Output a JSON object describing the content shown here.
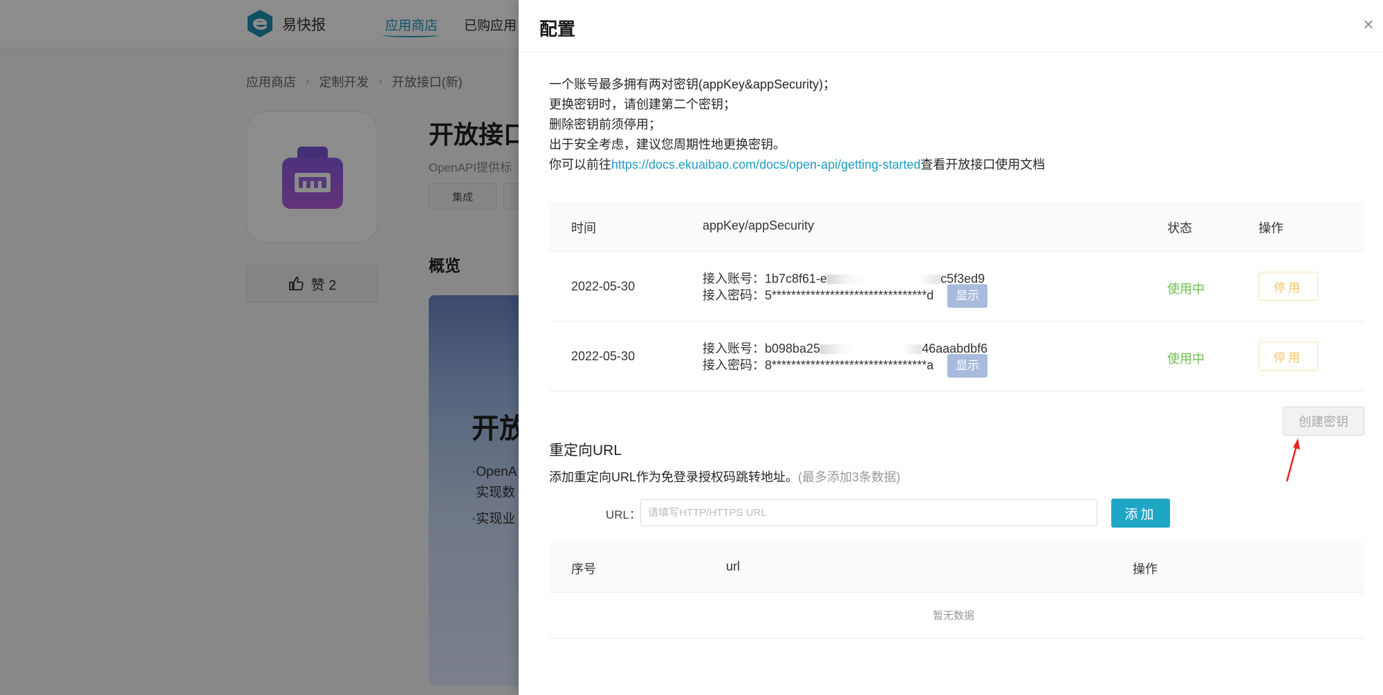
{
  "background": {
    "brand": "易快报",
    "nav": [
      "应用商店",
      "已购应用"
    ],
    "breadcrumb": [
      "应用商店",
      "定制开发",
      "开放接口(新)"
    ],
    "app_title": "开放接口",
    "app_desc": "OpenAPI提供标",
    "tag": "集成",
    "like_label": "赞 2",
    "section": "概览",
    "banner_title": "开放",
    "banner_lines": [
      "·OpenA",
      "实现数",
      "·实现业"
    ]
  },
  "drawer": {
    "title": "配置",
    "close": "×",
    "notes": [
      "一个账号最多拥有两对密钥(appKey&appSecurity)；",
      "更换密钥时，请创建第二个密钥；",
      "删除密钥前须停用；",
      "出于安全考虑，建议您周期性地更换密钥。"
    ],
    "doc_prefix": "你可以前往",
    "doc_link": "https://docs.ekuaibao.com/docs/open-api/getting-started",
    "doc_suffix": "查看开放接口使用文档",
    "keys_table": {
      "headers": [
        "时间",
        "appKey/appSecurity",
        "状态",
        "操作"
      ],
      "rows": [
        {
          "date": "2022-05-30",
          "account_label": "接入账号：",
          "account_start": "1b7c8f61-e",
          "account_end": "c5f3ed9",
          "secret_label": "接入密码：",
          "secret": "5********************************d",
          "show": "显示",
          "status": "使用中",
          "action": "停用"
        },
        {
          "date": "2022-05-30",
          "account_label": "接入账号：",
          "account_start": "b098ba25",
          "account_end": "46aaabdbf6",
          "secret_label": "接入密码：",
          "secret": "8********************************a",
          "show": "显示",
          "status": "使用中",
          "action": "停用"
        }
      ]
    },
    "create_key": "创建密钥",
    "redirect": {
      "title": "重定向URL",
      "desc": "添加重定向URL作为免登录授权码跳转地址。",
      "hint": "(最多添加3条数据)",
      "url_label": "URL：",
      "url_placeholder": "请填写HTTP/HTTPS URL",
      "url_value": "",
      "add": "添加",
      "headers": [
        "序号",
        "url",
        "操作"
      ],
      "empty": "暂无数据"
    }
  },
  "colors": {
    "accent": "#1ea7c4",
    "link": "#1f9cc0",
    "status_ok": "#6cc04a",
    "stop": "#f4c26b",
    "show_btn": "#a8bbdd"
  }
}
